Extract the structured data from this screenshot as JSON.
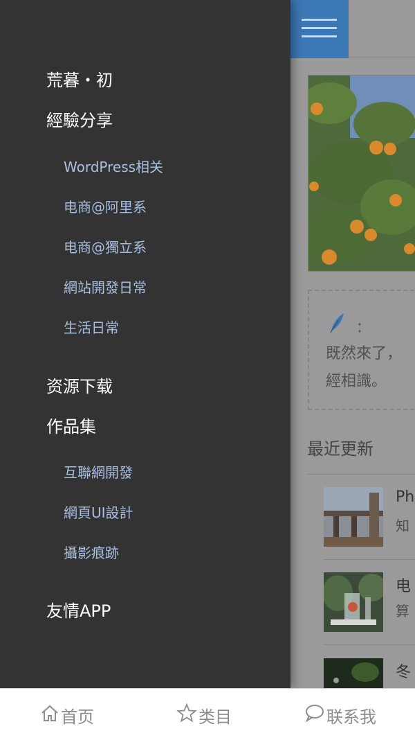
{
  "drawer": {
    "site_title": "荒暮・初",
    "section_experience": "經驗分享",
    "experience_items": [
      "WordPress相关",
      "电商@阿里系",
      "电商@獨立系",
      "網站開發日常",
      "生活日常"
    ],
    "section_downloads": "资源下载",
    "section_portfolio": "作品集",
    "portfolio_items": [
      "互聯網開發",
      "網頁UI設計",
      "攝影痕跡"
    ],
    "section_friends": "友情APP"
  },
  "main": {
    "notice_colon": "：",
    "notice_line1": "既然來了，",
    "notice_line2": "經相識。",
    "recent_title": "最近更新",
    "posts": [
      {
        "title": "Ph",
        "snippet": "知"
      },
      {
        "title": "电",
        "snippet": "算"
      },
      {
        "title": "冬",
        "snippet": ""
      }
    ]
  },
  "bottom_nav": {
    "home": "首页",
    "categories": "类目",
    "contact": "联系我"
  },
  "colors": {
    "drawer_bg": "#333333",
    "sub_item": "#a8bfe0",
    "accent": "#3b77b4"
  }
}
